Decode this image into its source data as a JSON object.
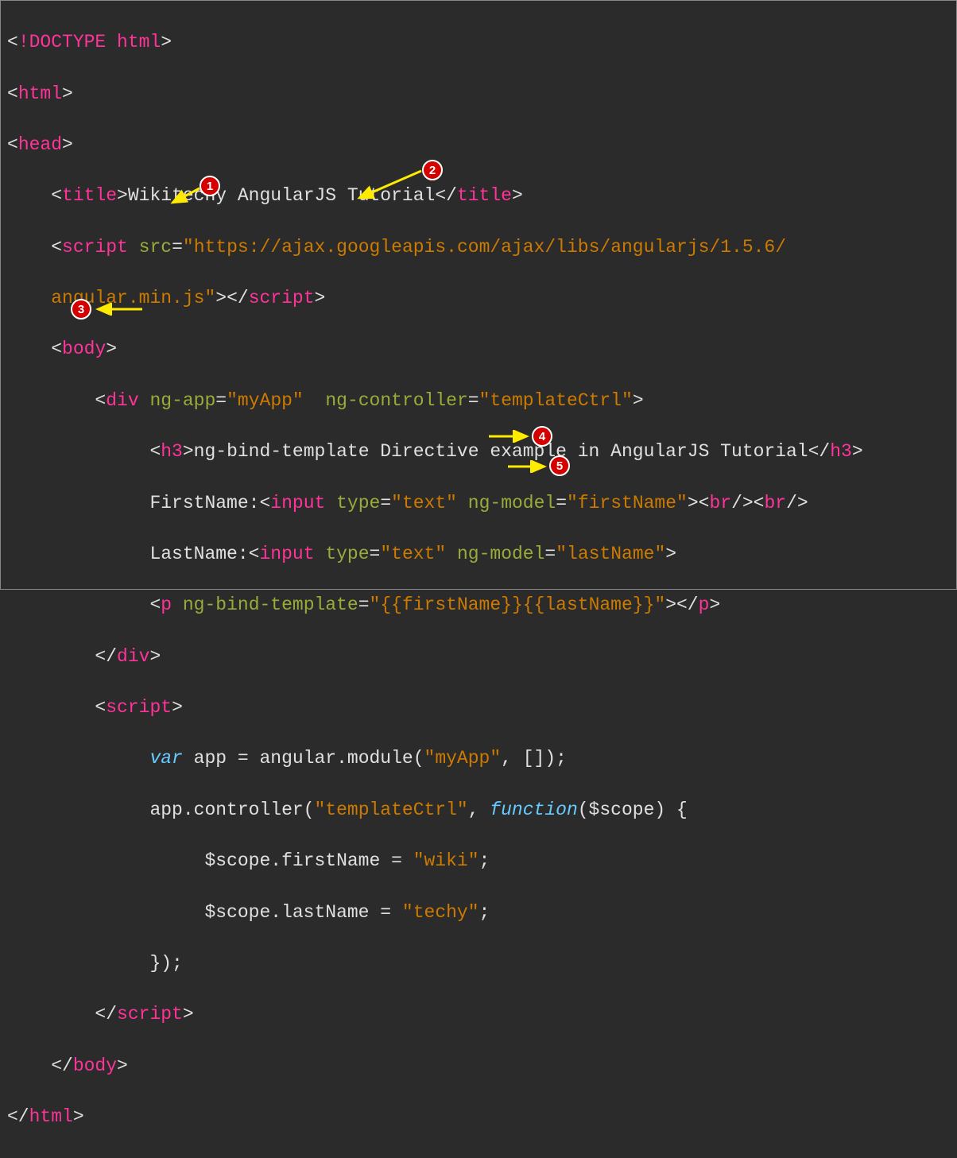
{
  "lines": {
    "l1": {
      "tag": "!DOCTYPE html"
    },
    "l2": {
      "tag": "html"
    },
    "l3": {
      "tag": "head"
    },
    "l4": {
      "indent": "    ",
      "tag": "title",
      "text": "Wikitechy AngularJS Tutorial"
    },
    "l5": {
      "indent": "    ",
      "tag": "script",
      "attr": "src",
      "val": "\"https://ajax.googleapis.com/ajax/libs/angularjs/1.5.6/"
    },
    "l6": {
      "indent": "    ",
      "cont": "angular.min.js\"",
      "closetag": "script"
    },
    "l7": {
      "indent": "    ",
      "tag": "body"
    },
    "l8": {
      "indent": "        ",
      "tag": "div",
      "attr1": "ng-app",
      "val1": "\"myApp\"",
      "attr2": "ng-controller",
      "val2": "\"templateCtrl\""
    },
    "l9": {
      "indent": "             ",
      "tag": "h3",
      "text": "ng-bind-template Directive example in AngularJS Tutorial"
    },
    "l10": {
      "indent": "             ",
      "label": "FirstName:",
      "tag": "input",
      "attr1": "type",
      "val1": "\"text\"",
      "attr2": "ng-model",
      "val2": "\"firstName\"",
      "br": "br"
    },
    "l11": {
      "indent": "             ",
      "label": "LastName:",
      "tag": "input",
      "attr1": "type",
      "val1": "\"text\"",
      "attr2": "ng-model",
      "val2": "\"lastName\""
    },
    "l12": {
      "indent": "             ",
      "tag": "p",
      "attr": "ng-bind-template",
      "val": "\"{{firstName}}{{lastName}}\""
    },
    "l13": {
      "indent": "        ",
      "tag": "div"
    },
    "l14": {
      "indent": "        ",
      "tag": "script"
    },
    "l15": {
      "indent": "             ",
      "kw": "var",
      "text": " app = angular.module(",
      "str": "\"myApp\"",
      "text2": ", []);"
    },
    "l16": {
      "indent": "             ",
      "text": "app.controller(",
      "str": "\"templateCtrl\"",
      "text2": ", ",
      "fn": "function",
      "text3": "($scope) {"
    },
    "l17": {
      "indent": "                  ",
      "text": "$scope.firstName = ",
      "str": "\"wiki\"",
      "text2": ";"
    },
    "l18": {
      "indent": "                  ",
      "text": "$scope.lastName = ",
      "str": "\"techy\"",
      "text2": ";"
    },
    "l19": {
      "indent": "             ",
      "text": "});"
    },
    "l20": {
      "indent": "        ",
      "tag": "script"
    },
    "l21": {
      "indent": "    ",
      "tag": "body"
    },
    "l22": {
      "tag": "html"
    }
  },
  "badges": {
    "b1": "1",
    "b2": "2",
    "b3": "3",
    "b4": "4",
    "b5": "5"
  }
}
